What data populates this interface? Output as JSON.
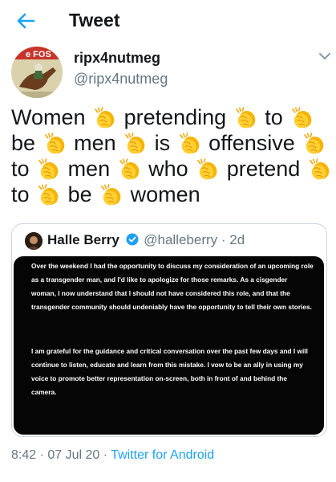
{
  "header": {
    "title": "Tweet",
    "back_icon": "arrow-left-icon",
    "accent_color": "#1da1f2"
  },
  "author": {
    "name": "ripx4nutmeg",
    "handle": "@ripx4nutmeg"
  },
  "tweet": {
    "words": [
      "Women",
      "pretending",
      "to",
      "be",
      "men",
      "is",
      "offensive",
      "to",
      "men",
      "who",
      "pretend",
      "to",
      "be",
      "women"
    ],
    "separator_emoji": "clapping-hands"
  },
  "quoted": {
    "name": "Halle Berry",
    "verified_icon": "verified-badge-icon",
    "handle": "@halleberry",
    "time": "· 2d",
    "statement": [
      "Over the weekend I had the opportunity to discuss my consideration of an upcoming role as a transgender man, and I'd like to apologize for those remarks. As a cisgender woman, I now understand that I should not have considered this role, and that the transgender community should undeniably have the opportunity to tell their own stories.",
      "I am grateful for the guidance and critical conversation over the past few days and I will continue to listen, educate and learn from this mistake. I vow to be an ally in using my voice to promote better representation on-screen, both in front of and behind the camera."
    ]
  },
  "meta": {
    "timestamp": "8:42 · 07 Jul 20 ·",
    "source": "Twitter for Android"
  }
}
